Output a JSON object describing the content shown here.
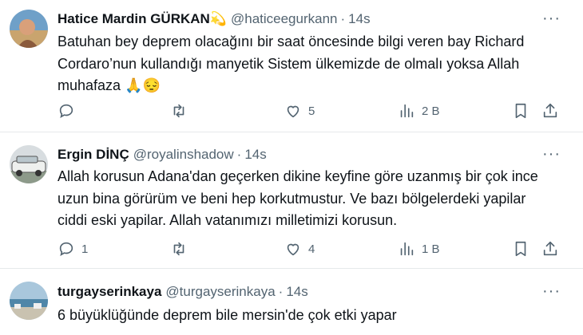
{
  "tweets": [
    {
      "name": "Hatice Mardin GÜRKAN",
      "name_emoji": "💫",
      "handle": "@haticeegurkann",
      "time": "14s",
      "text": "Batuhan bey deprem olacağını bir saat öncesinde bilgi veren bay Richard Cordaro’nun kullandığı manyetik Sistem ülkemizde de olmalı yoksa Allah muhafaza 🙏😔",
      "replies": "",
      "retweets": "",
      "likes": "5",
      "views": "2 B"
    },
    {
      "name": "Ergin DİNÇ",
      "handle": "@royalinshadow",
      "time": "14s",
      "text": "Allah korusun Adana'dan geçerken dikine keyfine göre uzanmış bir çok ince uzun bina görürüm ve beni hep korkutmustur. Ve bazı bölgelerdeki yapilar ciddi eski yapilar. Allah vatanımızı milletimizi korusun.",
      "replies": "1",
      "retweets": "",
      "likes": "4",
      "views": "1 B"
    },
    {
      "name": "turgayserinkaya",
      "handle": "@turgayserinkaya",
      "time": "14s",
      "text": "6 büyüklüğünde deprem bile mersin'de çok etki yapar"
    }
  ],
  "ui": {
    "dot": "·",
    "more": "···"
  },
  "colors": {
    "text": "#0f1419",
    "secondary": "#536471",
    "divider": "#e6e9eb"
  }
}
